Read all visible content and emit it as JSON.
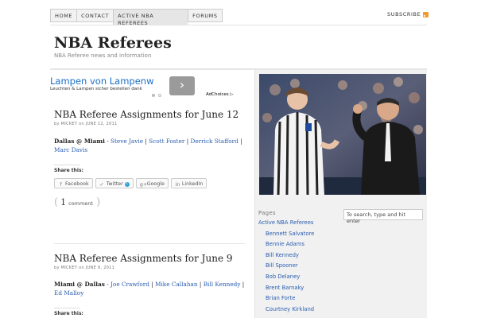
{
  "nav": {
    "tabs": [
      {
        "label": "Home"
      },
      {
        "label": "Contact"
      },
      {
        "label": "Active NBA Referees"
      },
      {
        "label": "Forums"
      }
    ],
    "subscribe_label": "SUBSCRIBE"
  },
  "header": {
    "title": "NBA Referees",
    "description": "NBA Referee news and information"
  },
  "ad": {
    "title": "Lampen von Lampenw",
    "text": "Leuchten & Lampen sicher bestellen dank",
    "arrow_label": "›",
    "adchoices": "AdChoices"
  },
  "posts": [
    {
      "title": "NBA Referee Assignments for June 12",
      "by": "by",
      "author": "Mickey",
      "on": "on",
      "date": "June 12, 2011",
      "game": "Dallas @ Miami",
      "dash": " - ",
      "refs": [
        "Steve Javie",
        "Scott Foster",
        "Derrick Stafford",
        "Marc Davis"
      ],
      "share_label": "Share this:",
      "share": {
        "facebook": "Facebook",
        "twitter": "Twitter",
        "twitter_count": "1",
        "google": "Google",
        "linkedin": "LinkedIn"
      },
      "comments_count": "1",
      "comments_label": "comment"
    },
    {
      "title": "NBA Referee Assignments for June 9",
      "by": "by",
      "author": "Mickey",
      "on": "on",
      "date": "June 9, 2011",
      "game": "Miami @ Dallas",
      "dash": " - ",
      "refs": [
        "Joe Crawford",
        "Mike Callahan",
        "Bill Kennedy",
        "Ed Malloy"
      ],
      "share_label": "Share this:"
    }
  ],
  "sidebar": {
    "search_placeholder": "To search, type and hit enter",
    "pages_heading": "Pages",
    "pages": [
      {
        "label": "Active NBA Referees",
        "sub": false
      },
      {
        "label": "Bennett Salvatore",
        "sub": true
      },
      {
        "label": "Bennie Adams",
        "sub": true
      },
      {
        "label": "Bill Kennedy",
        "sub": true
      },
      {
        "label": "Bill Spooner",
        "sub": true
      },
      {
        "label": "Bob Delaney",
        "sub": true
      },
      {
        "label": "Brent Barnaky",
        "sub": true
      },
      {
        "label": "Brian Forte",
        "sub": true
      },
      {
        "label": "Courtney Kirkland",
        "sub": true
      }
    ]
  }
}
